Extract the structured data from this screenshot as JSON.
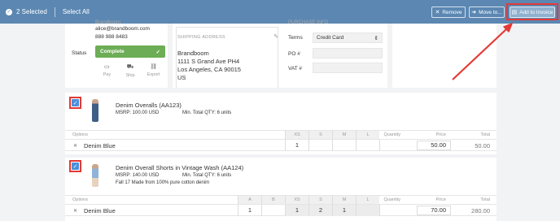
{
  "topbar": {
    "selected_label": "2 Selected",
    "select_all_label": "Select All",
    "remove_label": "Remove",
    "move_label": "Move to...",
    "invoice_label": "Add to Invoice"
  },
  "contact": {
    "partial_top": "Brandboom",
    "email": "alice@brandboom.com",
    "phone": "888 988 8483",
    "status_label": "Status",
    "status_value": "Complete",
    "actions": [
      "Pay",
      "Ship",
      "Export"
    ]
  },
  "address": {
    "title": "SHIPPING ADDRESS",
    "lines": [
      "Brandboom",
      "1111 S Grand Ave PH4",
      "Los Angeles, CA 90015",
      "US"
    ]
  },
  "purchase": {
    "title": "PURCHASE INFO",
    "terms_label": "Terms",
    "terms_value": "Credit Card",
    "po_label": "PO #",
    "vat_label": "VAT #"
  },
  "table_headers": {
    "options": "Options",
    "quantity": "Quantity",
    "price": "Price",
    "total": "Total"
  },
  "products": [
    {
      "name": "Denim Overalls (AA123)",
      "msrp": "MSRP: 100.00 USD",
      "min_total": "Min. Total QTY: 6 units",
      "sizes": [
        "XS",
        "S",
        "M",
        "L"
      ],
      "option": "Denim Blue",
      "quantities": [
        "1",
        "",
        "",
        ""
      ],
      "price": "50.00",
      "total": "50.00"
    },
    {
      "name": "Denim Overall Shorts in Vintage Wash (AA124)",
      "msrp": "MSRP: 140.00 USD",
      "min_total": "Min. Total QTY: 6 units",
      "description": "Fall 17 Made from 100% pure cotton denim",
      "sizes": [
        "A",
        "B",
        "XS",
        "S",
        "M",
        "L"
      ],
      "option": "Denim Blue",
      "quantities": [
        "1",
        "",
        "1",
        "2",
        "1",
        ""
      ],
      "price": "70.00",
      "total": "280.00"
    }
  ],
  "colors": {
    "topbar": "#5b87b2",
    "highlight": "#e53935",
    "checkbox": "#4a90d9",
    "status_green": "#6cad55"
  }
}
